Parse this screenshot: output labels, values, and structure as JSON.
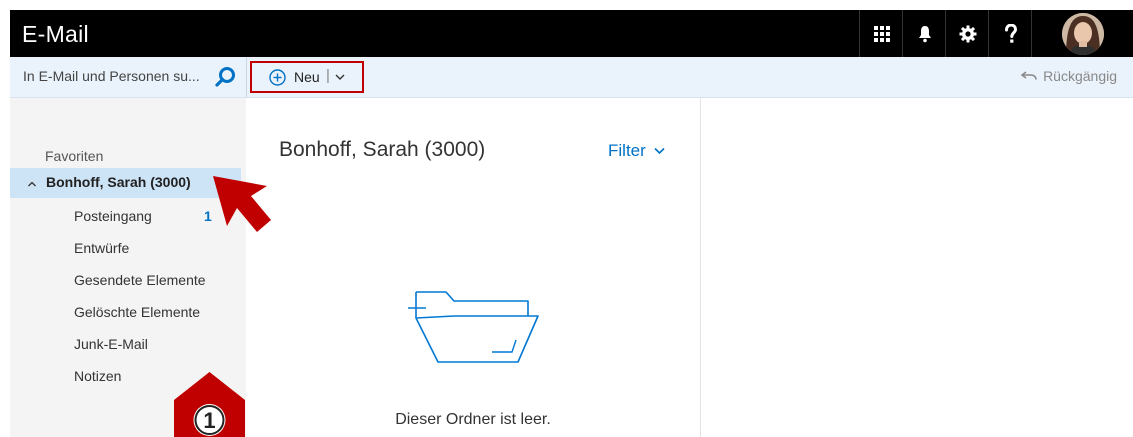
{
  "header": {
    "app_title": "E-Mail"
  },
  "search": {
    "placeholder": "In E-Mail und Personen su..."
  },
  "toolbar": {
    "new_label": "Neu",
    "new_separator": "|",
    "undo_label": "Rückgängig"
  },
  "nav": {
    "favorites_label": "Favoriten",
    "account_label": "Bonhoff, Sarah (3000)",
    "folders": [
      {
        "label": "Posteingang",
        "count": "1"
      },
      {
        "label": "Entwürfe"
      },
      {
        "label": "Gesendete Elemente"
      },
      {
        "label": "Gelöschte Elemente"
      },
      {
        "label": "Junk-E-Mail"
      },
      {
        "label": "Notizen"
      }
    ]
  },
  "message_list": {
    "title": "Bonhoff, Sarah (3000)",
    "filter_label": "Filter",
    "empty_text": "Dieser Ordner ist leer."
  },
  "annotation": {
    "step_number": "1"
  },
  "icons": [
    "app-launcher-icon",
    "bell-icon",
    "gear-icon",
    "help-icon",
    "avatar",
    "search-icon",
    "plus-circle-icon",
    "chevron-down-icon",
    "undo-icon",
    "empty-folder-icon"
  ],
  "colors": {
    "topbar": "#000000",
    "commandbar": "#eaf3fb",
    "accent": "#0072c6",
    "selection": "#cde3f6",
    "annotation_red": "#c00000"
  }
}
